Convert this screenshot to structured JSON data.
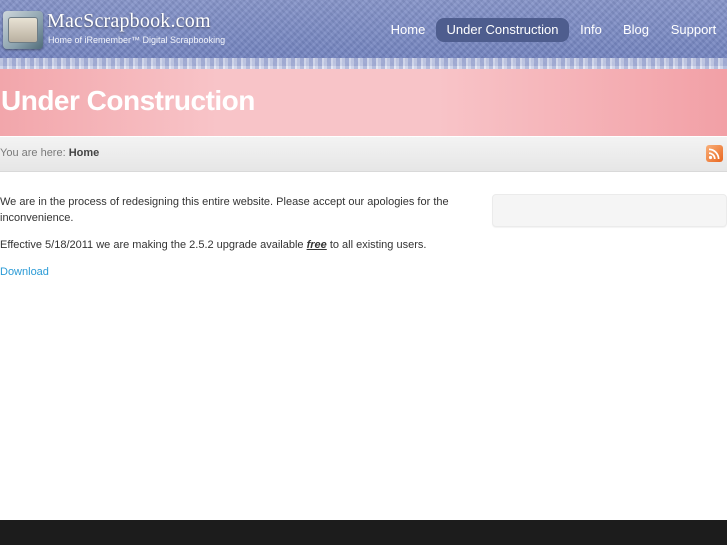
{
  "header": {
    "logo_title": "MacScrapbook.com",
    "logo_subtitle": "Home of iRemember™ Digital Scrapbooking",
    "nav": [
      {
        "label": "Home",
        "active": false
      },
      {
        "label": "Under Construction",
        "active": true
      },
      {
        "label": "Info",
        "active": false
      },
      {
        "label": "Blog",
        "active": false
      },
      {
        "label": "Support",
        "active": false
      }
    ]
  },
  "page": {
    "title": "Under Construction"
  },
  "breadcrumb": {
    "prefix": "You are here:",
    "current": "Home",
    "feed_icon": "rss-icon"
  },
  "content": {
    "paragraph1": "We are in the process of redesigning this entire website.   Please accept our apologies for the inconvenience.",
    "paragraph2_before": "Effective 5/18/2011 we are making the 2.5.2 upgrade available ",
    "paragraph2_emph": "free",
    "paragraph2_after": " to all existing users.",
    "download_link": "Download"
  },
  "colors": {
    "header": "#7585c0",
    "title_band": "#f6b8bd",
    "active_nav": "#4e5d8e",
    "link": "#2b9bd6",
    "footer": "#1c1c1c"
  }
}
